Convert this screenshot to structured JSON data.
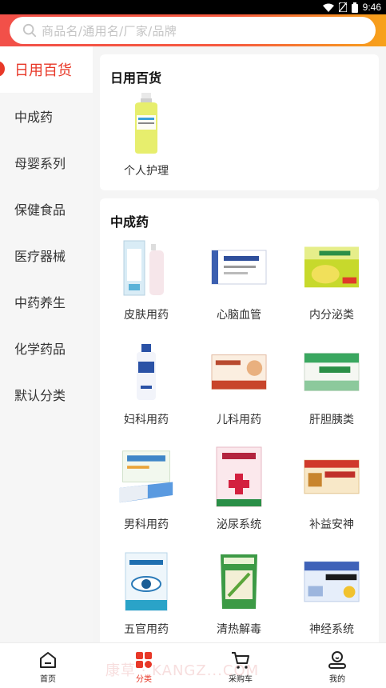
{
  "status": {
    "time": "9:46"
  },
  "search": {
    "placeholder": "商品名/通用名/厂家/品牌"
  },
  "sidebar": {
    "items": [
      {
        "label": "日用百货",
        "active": true
      },
      {
        "label": "中成药"
      },
      {
        "label": "母婴系列"
      },
      {
        "label": "保健食品"
      },
      {
        "label": "医疗器械"
      },
      {
        "label": "中药养生"
      },
      {
        "label": "化学药品"
      },
      {
        "label": "默认分类"
      }
    ]
  },
  "sections": [
    {
      "title": "日用百货",
      "items": [
        {
          "label": "个人护理"
        }
      ]
    },
    {
      "title": "中成药",
      "items": [
        {
          "label": "皮肤用药"
        },
        {
          "label": "心脑血管"
        },
        {
          "label": "内分泌类"
        },
        {
          "label": "妇科用药"
        },
        {
          "label": "儿科用药"
        },
        {
          "label": "肝胆胰类"
        },
        {
          "label": "男科用药"
        },
        {
          "label": "泌尿系统"
        },
        {
          "label": "补益安神"
        },
        {
          "label": "五官用药"
        },
        {
          "label": "清热解毒"
        },
        {
          "label": "神经系统"
        }
      ]
    }
  ],
  "bottom_nav": [
    {
      "label": "首页",
      "icon": "home-icon"
    },
    {
      "label": "分类",
      "icon": "category-icon",
      "active": true
    },
    {
      "label": "采购车",
      "icon": "cart-icon"
    },
    {
      "label": "我的",
      "icon": "user-icon"
    }
  ],
  "watermark": "康草 · KANGZ...COM",
  "colors": {
    "accent": "#e83828",
    "header_start": "#f25049",
    "header_end": "#f7a21a"
  }
}
